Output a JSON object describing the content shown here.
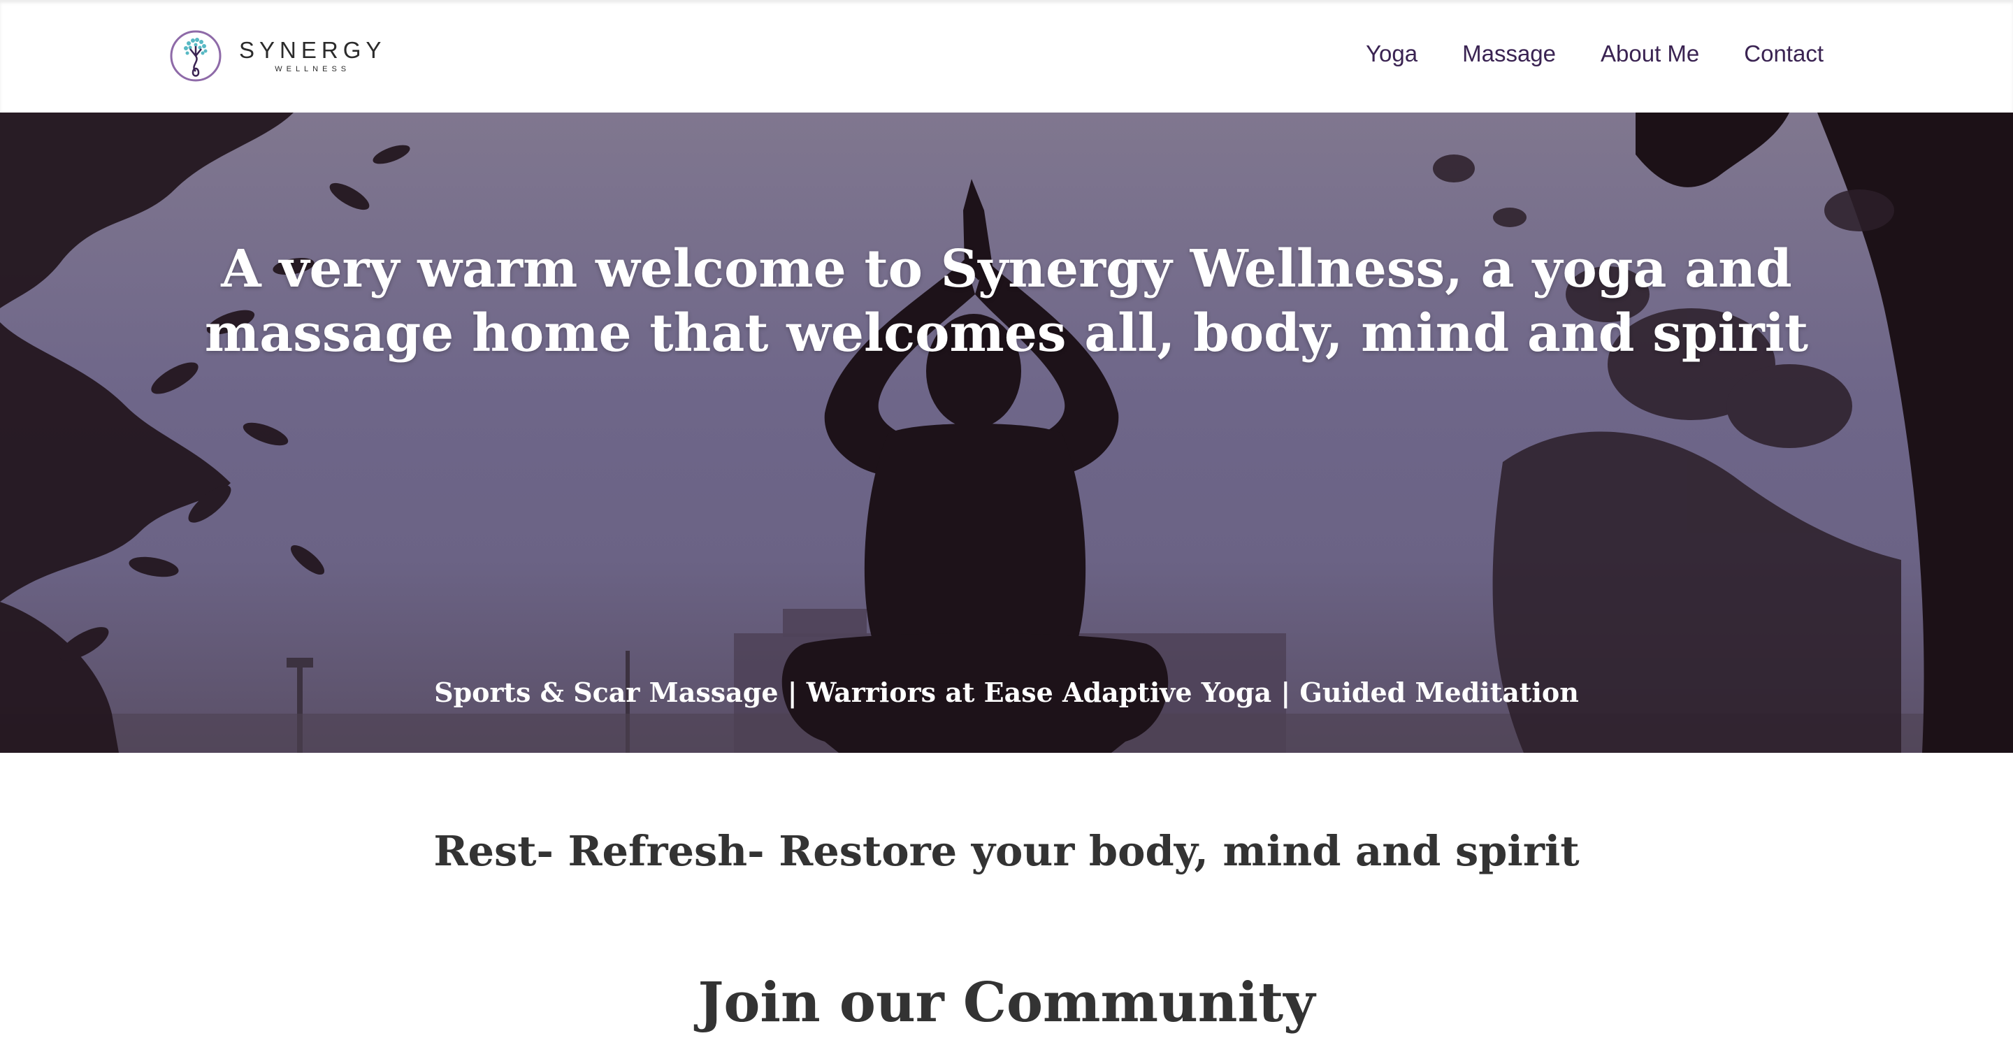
{
  "header": {
    "logo": {
      "name": "SYNERGY",
      "sub": "WELLNESS"
    },
    "nav": [
      {
        "label": "Yoga"
      },
      {
        "label": "Massage"
      },
      {
        "label": "About Me"
      },
      {
        "label": "Contact"
      }
    ],
    "nav_color": "#3a2352"
  },
  "hero": {
    "title": "A very warm welcome to Synergy Wellness, a yoga and massage home that welcomes all, body, mind and spirit",
    "services": "Sports & Scar Massage | Warriors at Ease Adaptive Yoga | Guided Meditation",
    "overlay_color": "#6e6689"
  },
  "tagline": "Rest- Refresh- Restore your body, mind and spirit",
  "community_heading": "Join our Community"
}
